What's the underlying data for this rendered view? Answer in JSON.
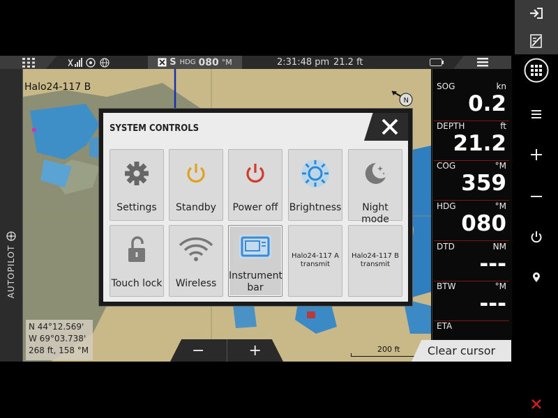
{
  "status_bar": {
    "hdg_prefix": "S",
    "hdg_label": "HDG",
    "hdg_value": "080",
    "hdg_unit": "°M",
    "time": "2:31:48 pm",
    "depth": "21.2 ft"
  },
  "map": {
    "title": "Halo24-117 B",
    "coords": [
      "N 44°12.569'",
      "W 69°03.738'",
      "268 ft, 158 °M"
    ],
    "scale": "200 ft",
    "autopilot_label": "AUTOPILOT",
    "zoom_out": "−",
    "zoom_in": "+",
    "clear_cursor": "Clear cursor",
    "north": "N"
  },
  "instruments": [
    {
      "label": "SOG",
      "unit": "kn",
      "value": "0.2"
    },
    {
      "label": "DEPTH",
      "unit": "ft",
      "value": "21.2"
    },
    {
      "label": "COG",
      "unit": "°M",
      "value": "359"
    },
    {
      "label": "HDG",
      "unit": "°M",
      "value": "080"
    },
    {
      "label": "DTD",
      "unit": "NM",
      "value": "---"
    },
    {
      "label": "BTW",
      "unit": "°M",
      "value": "---"
    },
    {
      "label": "ETA",
      "unit": "",
      "value": ""
    }
  ],
  "dialog": {
    "title": "SYSTEM CONTROLS",
    "tiles": [
      {
        "label": "Settings",
        "icon": "gear-icon"
      },
      {
        "label": "Standby",
        "icon": "power-icon"
      },
      {
        "label": "Power off",
        "icon": "power-icon"
      },
      {
        "label": "Brightness",
        "icon": "sun-icon"
      },
      {
        "label": "Night mode",
        "icon": "moon-icon"
      },
      {
        "label": "Touch lock",
        "icon": "lock-icon"
      },
      {
        "label": "Wireless",
        "icon": "wifi-icon"
      },
      {
        "label": "Instrument bar",
        "icon": "display-icon"
      },
      {
        "label": "Halo24-117 A transmit",
        "icon": ""
      },
      {
        "label": "Halo24-117 B transmit",
        "icon": ""
      }
    ]
  },
  "colors": {
    "standby": "#e0a020",
    "power_off": "#d23a2a",
    "brightness": "#2a8ad8",
    "instrument_bar": "#3a8ad8",
    "close_red": "#d02020"
  }
}
